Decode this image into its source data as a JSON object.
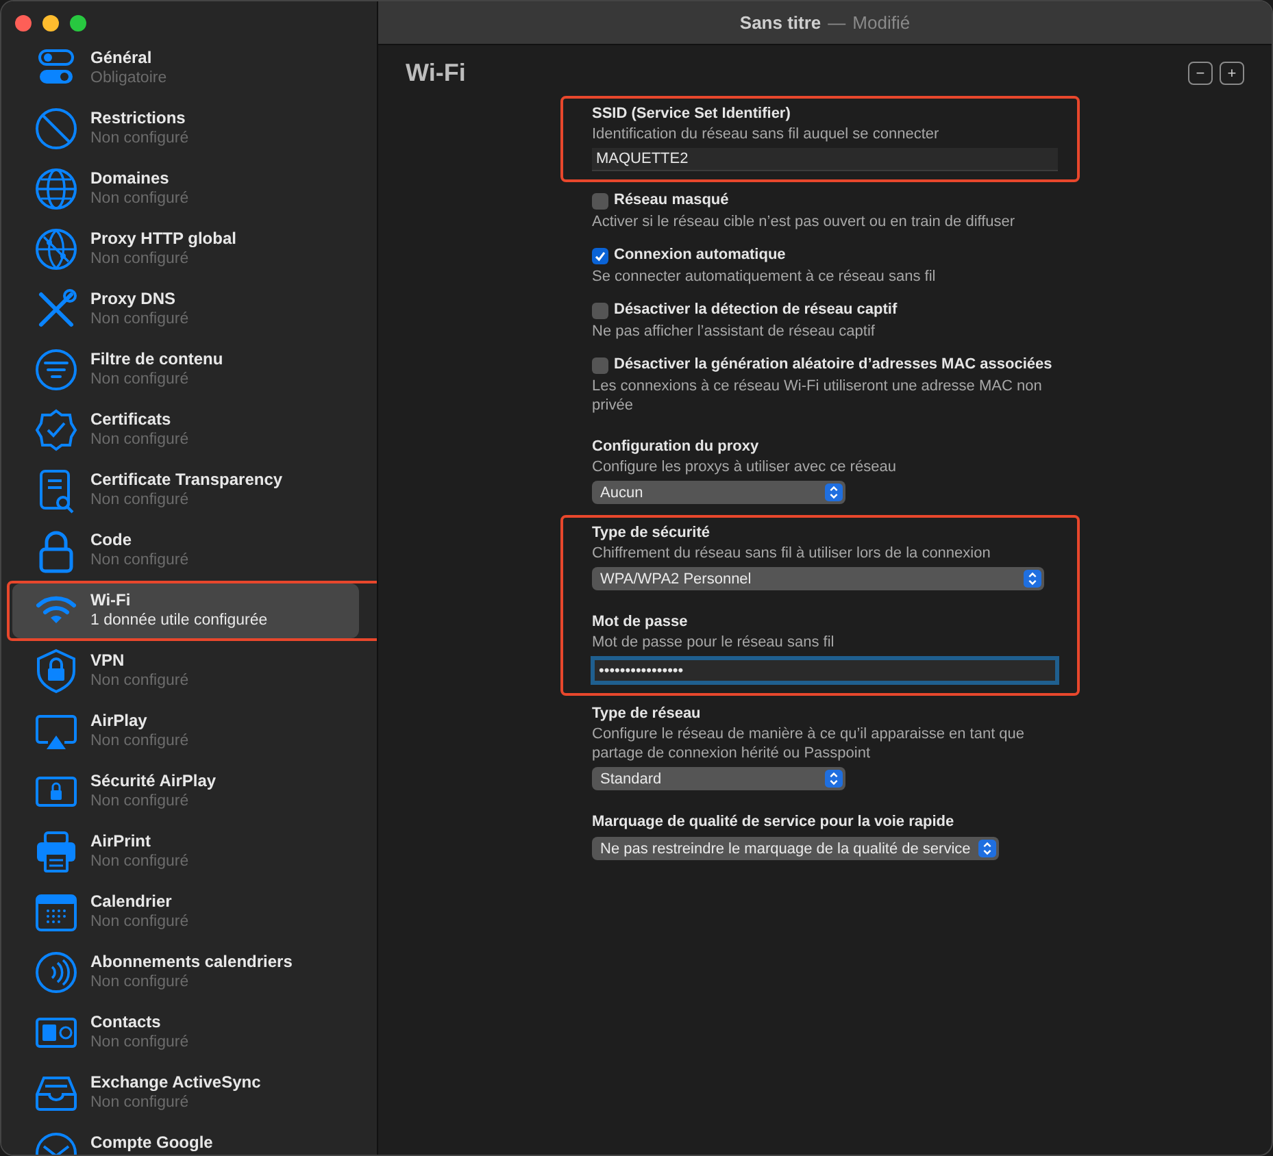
{
  "window": {
    "title": "Sans titre",
    "separator": "—",
    "status": "Modifié"
  },
  "sidebar": {
    "items": [
      {
        "title": "Général",
        "subtitle": "Obligatoire",
        "selected": false,
        "highlighted": false
      },
      {
        "title": "Restrictions",
        "subtitle": "Non configuré",
        "selected": false,
        "highlighted": false
      },
      {
        "title": "Domaines",
        "subtitle": "Non configuré",
        "selected": false,
        "highlighted": false
      },
      {
        "title": "Proxy HTTP global",
        "subtitle": "Non configuré",
        "selected": false,
        "highlighted": false
      },
      {
        "title": "Proxy DNS",
        "subtitle": "Non configuré",
        "selected": false,
        "highlighted": false
      },
      {
        "title": "Filtre de contenu",
        "subtitle": "Non configuré",
        "selected": false,
        "highlighted": false
      },
      {
        "title": "Certificats",
        "subtitle": "Non configuré",
        "selected": false,
        "highlighted": false
      },
      {
        "title": "Certificate Transparency",
        "subtitle": "Non configuré",
        "selected": false,
        "highlighted": false
      },
      {
        "title": "Code",
        "subtitle": "Non configuré",
        "selected": false,
        "highlighted": false
      },
      {
        "title": "Wi-Fi",
        "subtitle": "1 donnée utile configurée",
        "selected": true,
        "highlighted": true
      },
      {
        "title": "VPN",
        "subtitle": "Non configuré",
        "selected": false,
        "highlighted": false
      },
      {
        "title": "AirPlay",
        "subtitle": "Non configuré",
        "selected": false,
        "highlighted": false
      },
      {
        "title": "Sécurité AirPlay",
        "subtitle": "Non configuré",
        "selected": false,
        "highlighted": false
      },
      {
        "title": "AirPrint",
        "subtitle": "Non configuré",
        "selected": false,
        "highlighted": false
      },
      {
        "title": "Calendrier",
        "subtitle": "Non configuré",
        "selected": false,
        "highlighted": false
      },
      {
        "title": "Abonnements calendriers",
        "subtitle": "Non configuré",
        "selected": false,
        "highlighted": false
      },
      {
        "title": "Contacts",
        "subtitle": "Non configuré",
        "selected": false,
        "highlighted": false
      },
      {
        "title": "Exchange ActiveSync",
        "subtitle": "Non configuré",
        "selected": false,
        "highlighted": false
      },
      {
        "title": "Compte Google",
        "selected": false,
        "highlighted": false
      }
    ]
  },
  "content": {
    "heading": "Wi-Fi",
    "remove_button": "−",
    "add_button": "+",
    "groups": [
      {
        "highlighted": true,
        "fields": [
          {
            "kind": "text",
            "label": "SSID (Service Set Identifier)",
            "description": "Identification du réseau sans fil auquel se connecter",
            "value": "MAQUETTE2"
          }
        ]
      },
      {
        "highlighted": false,
        "fields": [
          {
            "kind": "checkbox",
            "label": "Réseau masqué",
            "checked": false,
            "description": "Activer si le réseau cible n’est pas ouvert ou en train de diffuser"
          },
          {
            "kind": "checkbox",
            "label": "Connexion automatique",
            "checked": true,
            "description": "Se connecter automatiquement à ce réseau sans fil"
          },
          {
            "kind": "checkbox",
            "label": "Désactiver la détection de réseau captif",
            "checked": false,
            "description": "Ne pas afficher l’assistant de réseau captif"
          },
          {
            "kind": "checkbox",
            "label": "Désactiver la génération aléatoire d’adresses MAC associées",
            "checked": false,
            "description": "Les connexions à ce réseau Wi-Fi utiliseront une adresse MAC non privée"
          },
          {
            "kind": "select",
            "label": "Configuration du proxy",
            "description": "Configure les proxys à utiliser avec ce réseau",
            "value": "Aucun"
          }
        ]
      },
      {
        "highlighted": true,
        "fields": [
          {
            "kind": "select",
            "label": "Type de sécurité",
            "description": "Chiffrement du réseau sans fil à utiliser lors de la connexion",
            "value": "WPA/WPA2 Personnel"
          },
          {
            "kind": "password",
            "label": "Mot de passe",
            "description": "Mot de passe pour le réseau sans fil",
            "value": "••••••••••••••••",
            "focused": true
          }
        ]
      },
      {
        "highlighted": false,
        "fields": [
          {
            "kind": "select",
            "label": "Type de réseau",
            "description": "Configure le réseau de manière à ce qu’il apparaisse en tant que partage de connexion hérité ou Passpoint",
            "value": "Standard"
          },
          {
            "kind": "select",
            "label": "Marquage de qualité de service pour la voie rapide",
            "value": "Ne pas restreindre le marquage de la qualité de service"
          }
        ]
      }
    ]
  }
}
